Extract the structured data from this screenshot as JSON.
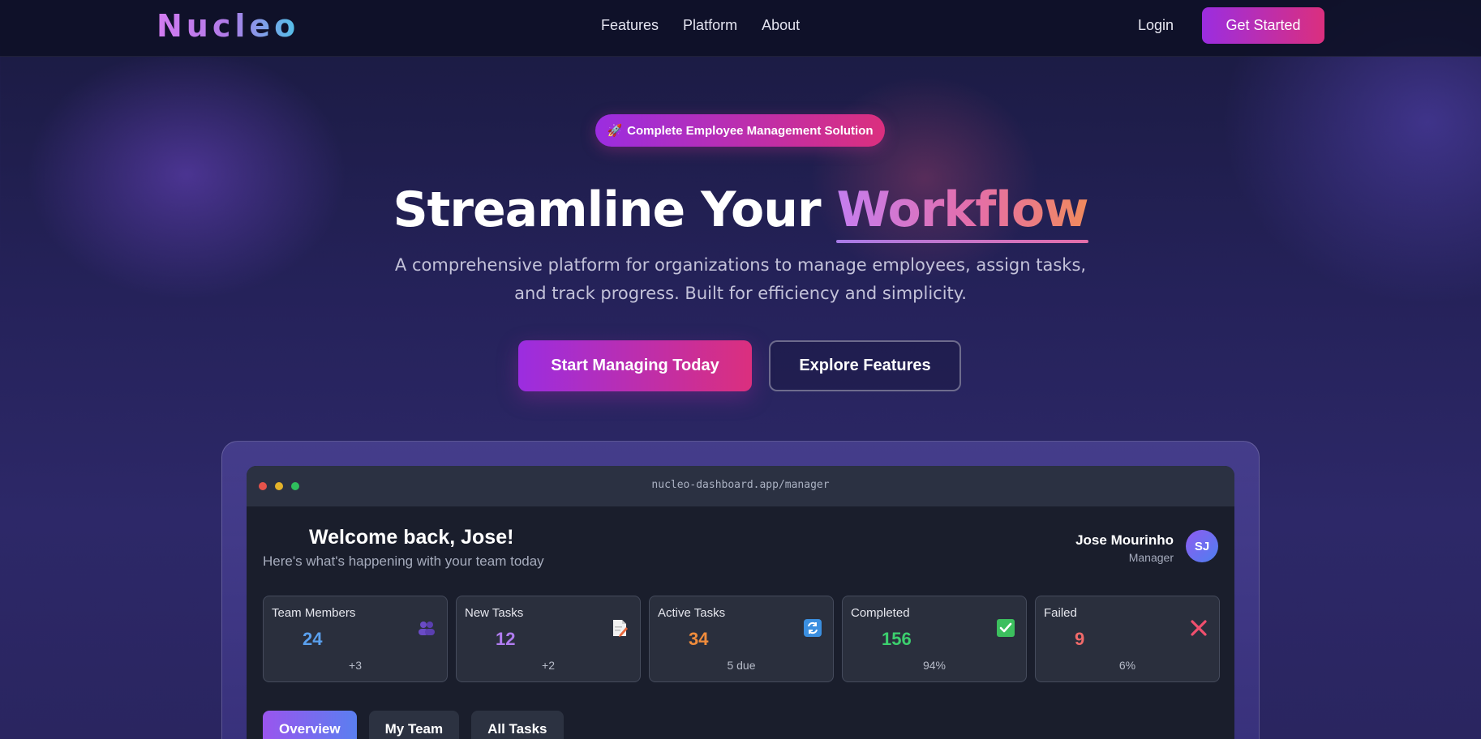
{
  "nav": {
    "logo": "Nucleo",
    "links": [
      "Features",
      "Platform",
      "About"
    ],
    "login": "Login",
    "cta": "Get Started"
  },
  "hero": {
    "badge_icon": "rocket-icon",
    "badge": "Complete Employee Management Solution",
    "headline_main": "Streamline Your ",
    "headline_highlight": "Workflow",
    "subtitle_line1": "A comprehensive platform for organizations to manage employees, assign tasks,",
    "subtitle_line2": "and track progress. Built for efficiency and simplicity.",
    "primary_button": "Start Managing Today",
    "secondary_button": "Explore Features"
  },
  "dashboard": {
    "url": "nucleo-dashboard.app/manager",
    "welcome": "Welcome back, Jose!",
    "welcome_sub": "Here's what's happening with your team today",
    "user_name": "Jose Mourinho",
    "user_role": "Manager",
    "avatar_initials": "SJ",
    "stats": [
      {
        "label": "Team Members",
        "value": "24",
        "delta": "+3",
        "color": "#5aa0ee",
        "icon": "people-icon"
      },
      {
        "label": "New Tasks",
        "value": "12",
        "delta": "+2",
        "color": "#b07cf0",
        "icon": "memo-icon"
      },
      {
        "label": "Active Tasks",
        "value": "34",
        "delta": "5 due",
        "color": "#f08c3c",
        "icon": "refresh-icon"
      },
      {
        "label": "Completed",
        "value": "156",
        "delta": "94%",
        "color": "#3ccf6e",
        "icon": "check-icon"
      },
      {
        "label": "Failed",
        "value": "9",
        "delta": "6%",
        "color": "#f06a6a",
        "icon": "close-icon"
      }
    ],
    "tabs": [
      "Overview",
      "My Team",
      "All Tasks"
    ]
  },
  "colors": {
    "accent_gradient_start": "#9b2de0",
    "accent_gradient_end": "#db2f7e",
    "background": "#25225a"
  }
}
